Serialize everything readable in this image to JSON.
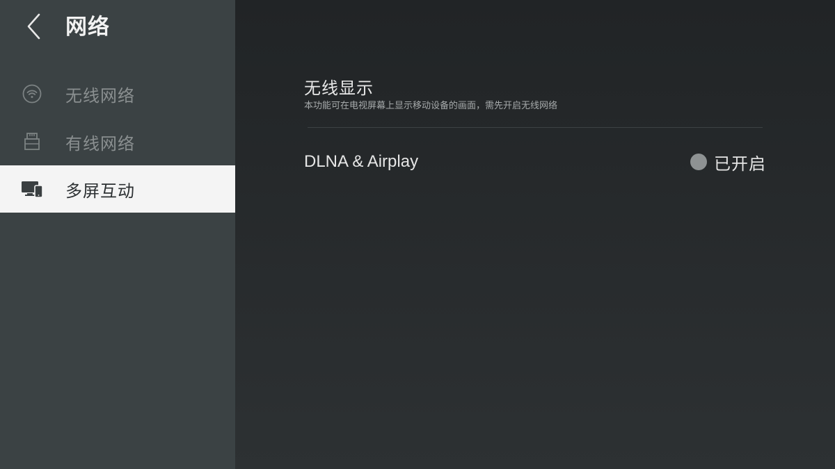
{
  "header": {
    "title": "网络",
    "back_icon": "chevron-left-icon"
  },
  "sidebar": {
    "items": [
      {
        "label": "无线网络",
        "icon": "wifi-icon",
        "active": false
      },
      {
        "label": "有线网络",
        "icon": "ethernet-icon",
        "active": false
      },
      {
        "label": "多屏互动",
        "icon": "multiscreen-icon",
        "active": true
      }
    ]
  },
  "main": {
    "section": {
      "title": "无线显示",
      "description": "本功能可在电视屏幕上显示移动设备的画面，需先开启无线网络"
    },
    "settings": [
      {
        "label": "DLNA & Airplay",
        "status": "已开启"
      }
    ]
  },
  "colors": {
    "sidebar_bg": "#3b4244",
    "main_bg": "#26292b",
    "active_item_bg": "#f4f4f4",
    "inactive_text": "#8a8f90",
    "status_dot": "#8e9293"
  }
}
